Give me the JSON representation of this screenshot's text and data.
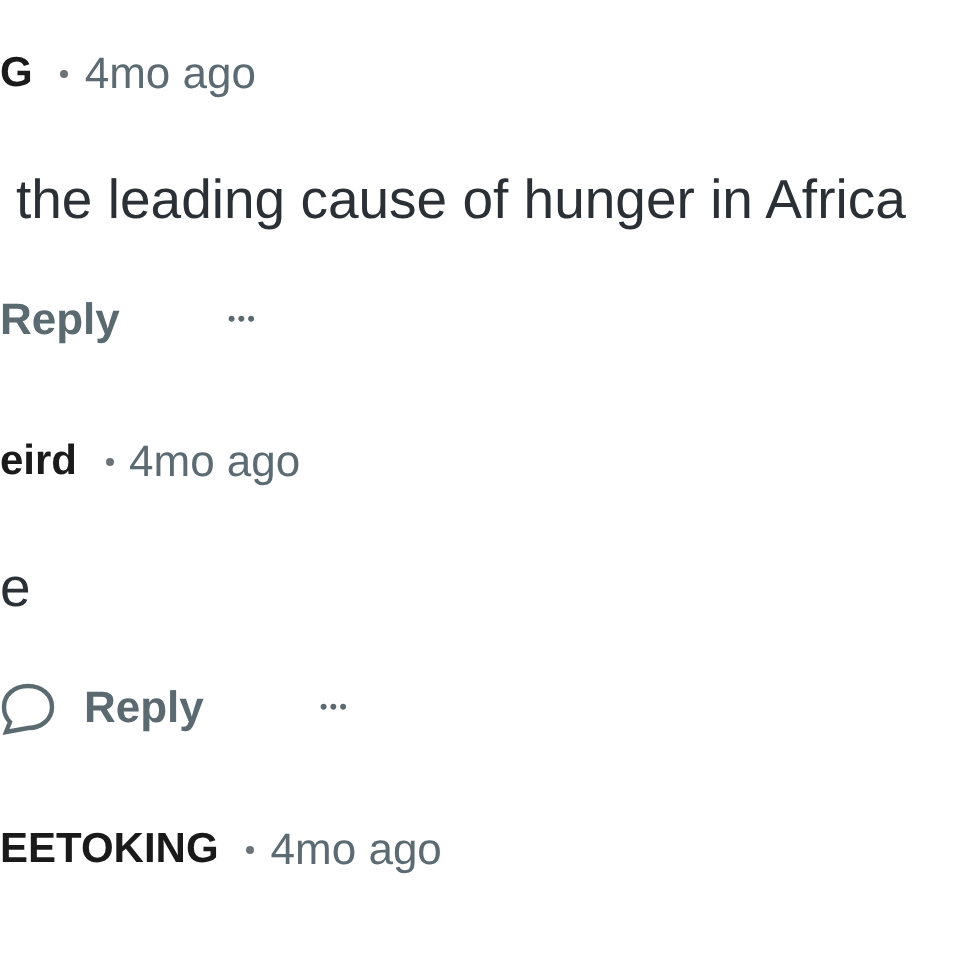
{
  "comments": [
    {
      "author": "G",
      "time": "4mo ago",
      "body": "the leading cause of hunger in Africa",
      "reply": "Reply",
      "reply_icon": false,
      "more": "•••"
    },
    {
      "author": "eird",
      "time": "4mo ago",
      "body": "e",
      "reply": "Reply",
      "reply_icon": true,
      "more": "•••"
    },
    {
      "author": "EETOKING",
      "time": "4mo ago"
    }
  ]
}
